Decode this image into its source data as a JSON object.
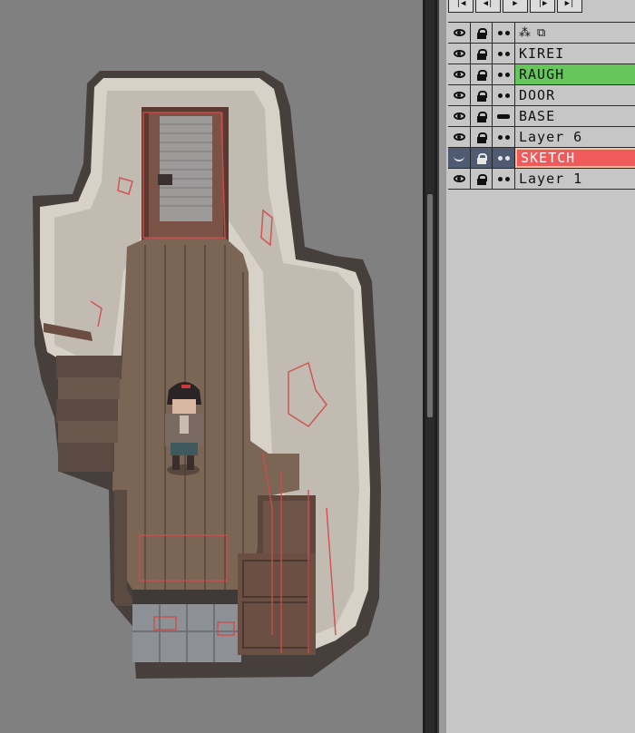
{
  "canvas": {
    "description_icon": "pixel-art-room-with-character"
  },
  "frame_controls": [
    {
      "name": "first-frame-button",
      "glyph": "|◀"
    },
    {
      "name": "prev-frame-button",
      "glyph": "◀|"
    },
    {
      "name": "play-button",
      "glyph": "▶"
    },
    {
      "name": "next-frame-button",
      "glyph": "|▶"
    },
    {
      "name": "last-frame-button",
      "glyph": "▶|"
    }
  ],
  "layers": [
    {
      "label": "KIREI",
      "visible": true,
      "locked": false,
      "linked": true,
      "highlight": "none"
    },
    {
      "label": "RAUGH",
      "visible": true,
      "locked": false,
      "linked": true,
      "highlight": "green"
    },
    {
      "label": "DOOR",
      "visible": true,
      "locked": false,
      "linked": true,
      "highlight": "none"
    },
    {
      "label": "BASE",
      "visible": true,
      "locked": false,
      "linked": false,
      "highlight": "none"
    },
    {
      "label": "Layer 6",
      "visible": true,
      "locked": false,
      "linked": true,
      "highlight": "none"
    },
    {
      "label": "SKETCH",
      "visible": false,
      "locked": false,
      "linked": true,
      "highlight": "red",
      "selected": true
    },
    {
      "label": "Layer 1",
      "visible": true,
      "locked": false,
      "linked": true,
      "highlight": "none"
    }
  ],
  "colors": {
    "canvas_bg": "#808080",
    "panel_bg": "#c6c6c6",
    "green_highlight": "#66c65c",
    "red_highlight": "#ef5b5b",
    "selected_row": "#4f5a73"
  }
}
